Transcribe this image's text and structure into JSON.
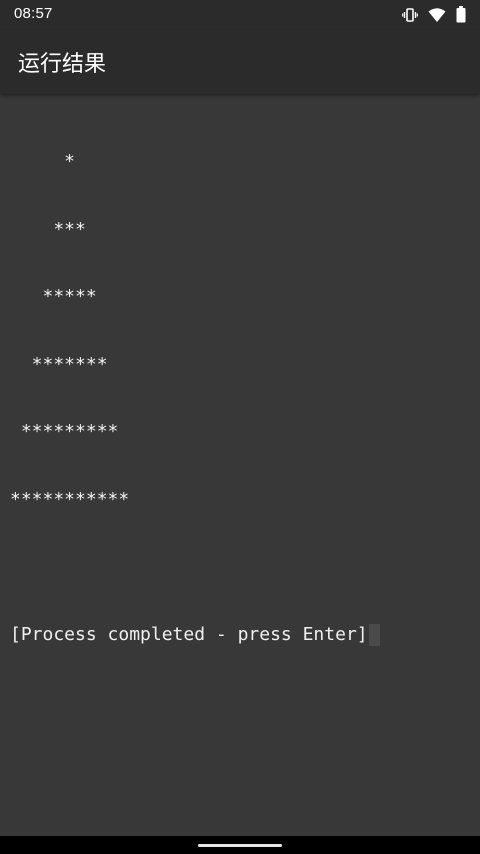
{
  "status_bar": {
    "time": "08:57",
    "icons": [
      "vibrate-icon",
      "wifi-icon",
      "battery-icon"
    ]
  },
  "app_bar": {
    "title": "运行结果"
  },
  "console": {
    "lines": [
      "     *",
      "    ***",
      "   *****",
      "  *******",
      " *********",
      "***********",
      "",
      "[Process completed - press Enter]"
    ]
  },
  "colors": {
    "bar_background": "#2b2b2b",
    "console_background": "#383838",
    "console_text": "#f0f0f0"
  }
}
